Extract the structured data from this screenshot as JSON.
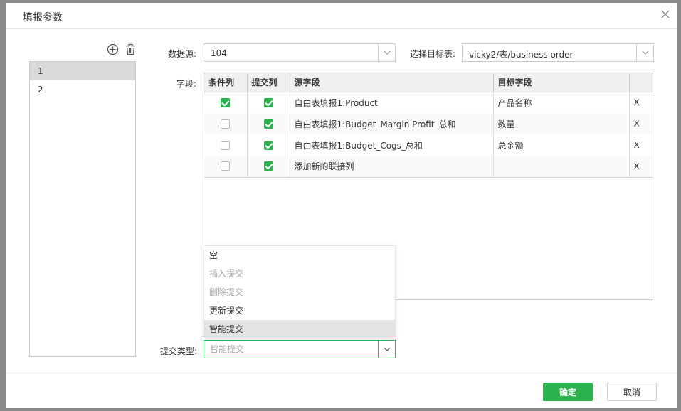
{
  "dialog": {
    "title": "填报参数",
    "close_icon": "close-icon"
  },
  "toolbar": {
    "add_icon": "plus-circle-icon",
    "delete_icon": "trash-icon"
  },
  "param_list": {
    "items": [
      {
        "label": "1",
        "selected": true
      },
      {
        "label": "2",
        "selected": false
      }
    ]
  },
  "form": {
    "datasource_label": "数据源:",
    "datasource_value": "104",
    "target_table_label": "选择目标表:",
    "target_table_value": "vicky2/表/business order",
    "fields_label": "字段:",
    "submit_type_label": "提交类型:",
    "submit_type_placeholder": "智能提交"
  },
  "grid": {
    "columns": [
      "条件列",
      "提交列",
      "源字段",
      "目标字段",
      ""
    ],
    "rows": [
      {
        "condition": true,
        "submit": true,
        "source": "自由表填报1:Product",
        "target": "产品名称",
        "action": "X"
      },
      {
        "condition": false,
        "submit": true,
        "source": "自由表填报1:Budget_Margin Profit_总和",
        "target": "数量",
        "action": "X"
      },
      {
        "condition": false,
        "submit": true,
        "source": "自由表填报1:Budget_Cogs_总和",
        "target": "总金额",
        "action": "X"
      },
      {
        "condition": false,
        "submit": true,
        "source": "添加新的联接列",
        "target": "",
        "action": "X"
      }
    ]
  },
  "dropdown": {
    "options": [
      {
        "label": "空",
        "disabled": false,
        "active": false
      },
      {
        "label": "插入提交",
        "disabled": true,
        "active": false
      },
      {
        "label": "删除提交",
        "disabled": true,
        "active": false
      },
      {
        "label": "更新提交",
        "disabled": false,
        "active": false
      },
      {
        "label": "智能提交",
        "disabled": false,
        "active": true
      }
    ]
  },
  "footer": {
    "ok_label": "确定",
    "cancel_label": "取消"
  },
  "colors": {
    "accent": "#2bb24c",
    "selected_row": "#d9d9d9",
    "border": "#cccccc"
  }
}
